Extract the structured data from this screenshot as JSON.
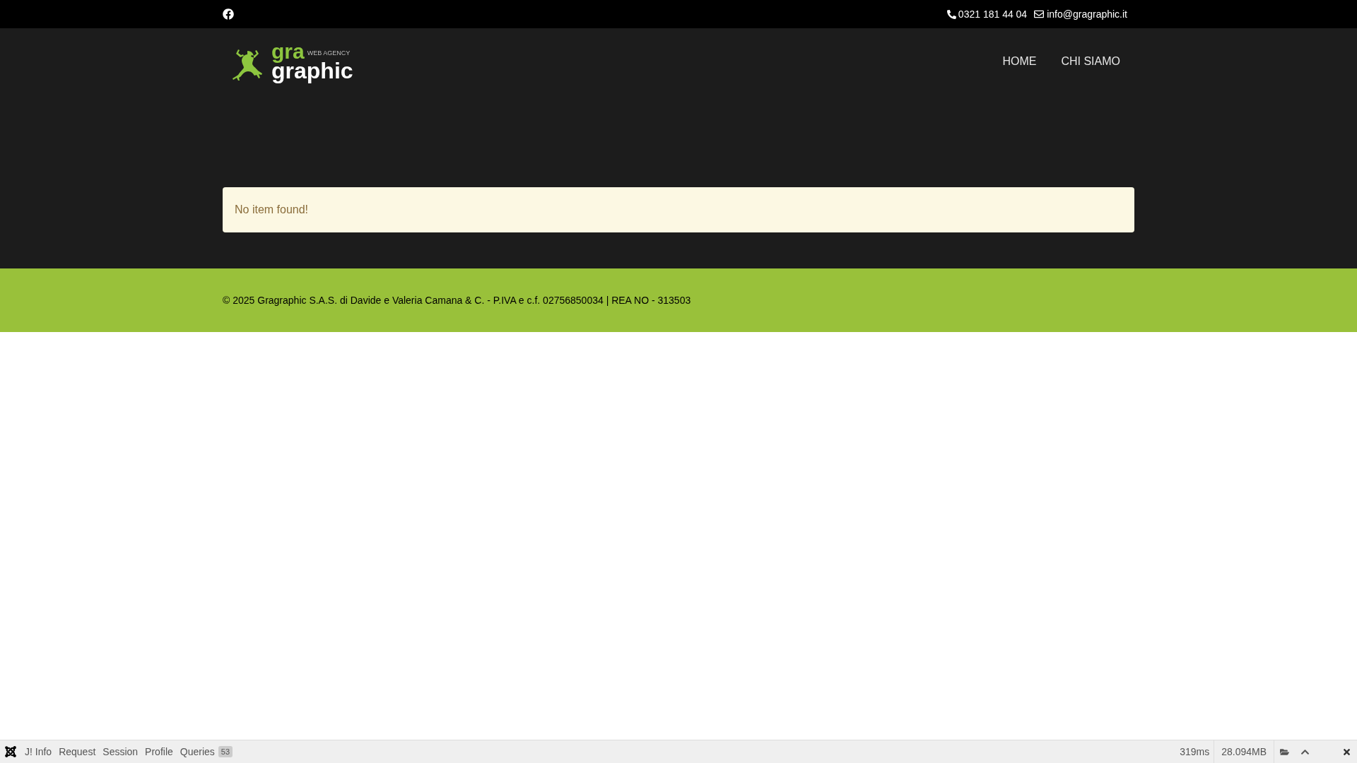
{
  "topbar": {
    "phone": "0321 181 44 04",
    "email": "info@gragraphic.it"
  },
  "logo": {
    "top": "gra",
    "tagline": "WEB AGENCY",
    "bottom": "graphic"
  },
  "nav": [
    {
      "label": "HOME"
    },
    {
      "label": "CHI SIAMO"
    }
  ],
  "alert": "No item found!",
  "footer": "© 2025 Gragraphic S.A.S. di Davide e Valeria Camana & C. - P.IVA e c.f. 02756850034 | REA NO - 313503",
  "debug": {
    "tabs": [
      {
        "label": "J! Info"
      },
      {
        "label": "Request"
      },
      {
        "label": "Session"
      },
      {
        "label": "Profile"
      },
      {
        "label": "Queries",
        "count": "53"
      }
    ],
    "time": "319ms",
    "memory": "28.094MB"
  }
}
